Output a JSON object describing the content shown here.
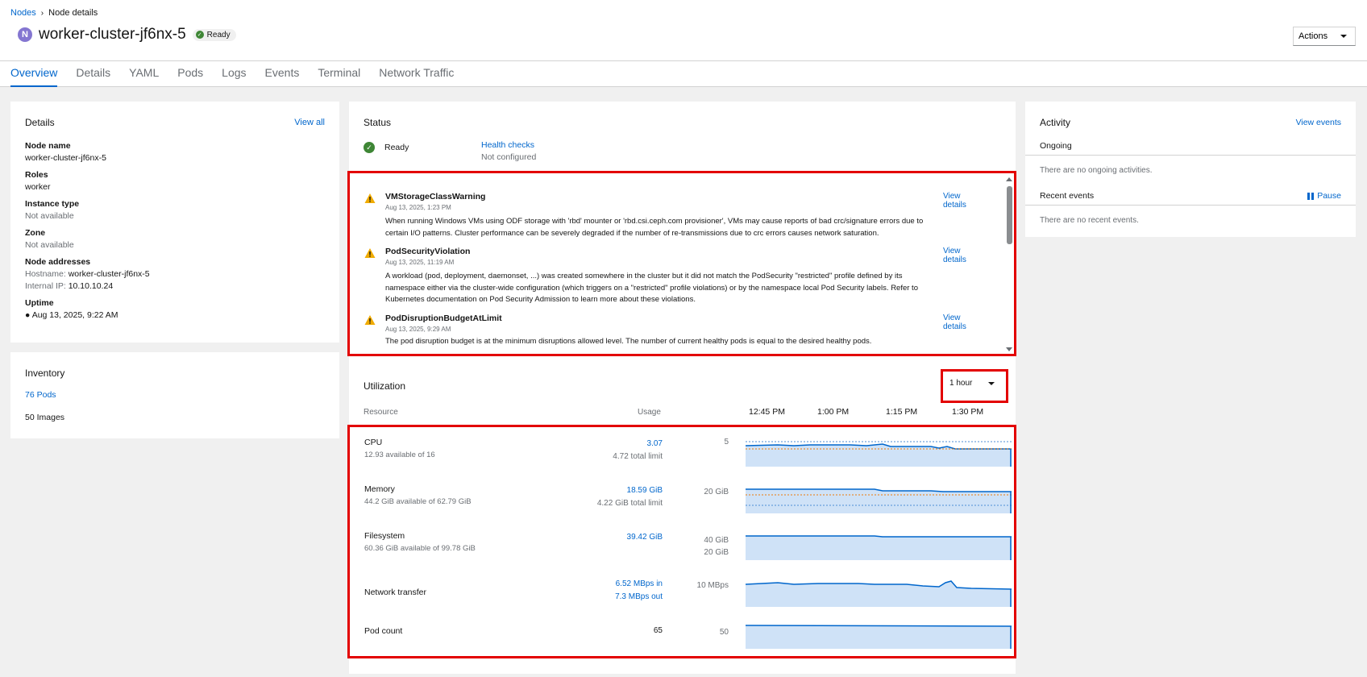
{
  "breadcrumb": {
    "parent": "Nodes",
    "current": "Node details"
  },
  "node": {
    "badge": "N",
    "name": "worker-cluster-jf6nx-5",
    "status": "Ready"
  },
  "header": {
    "actions_label": "Actions"
  },
  "tabs": [
    {
      "label": "Overview",
      "active": true
    },
    {
      "label": "Details"
    },
    {
      "label": "YAML"
    },
    {
      "label": "Pods"
    },
    {
      "label": "Logs"
    },
    {
      "label": "Events"
    },
    {
      "label": "Terminal"
    },
    {
      "label": "Network Traffic"
    }
  ],
  "details": {
    "title": "Details",
    "view_all": "View all",
    "node_name_label": "Node name",
    "node_name": "worker-cluster-jf6nx-5",
    "roles_label": "Roles",
    "roles": "worker",
    "instance_type_label": "Instance type",
    "instance_type": "Not available",
    "zone_label": "Zone",
    "zone": "Not available",
    "addresses_label": "Node addresses",
    "hostname_label": "Hostname:",
    "hostname": "worker-cluster-jf6nx-5",
    "internal_ip_label": "Internal IP:",
    "internal_ip": "10.10.10.24",
    "uptime_label": "Uptime",
    "uptime": "Aug 13, 2025, 9:22 AM"
  },
  "inventory": {
    "title": "Inventory",
    "pods": "76 Pods",
    "images": "50 Images"
  },
  "status": {
    "title": "Status",
    "state": "Ready",
    "health_checks": "Health checks",
    "health_state": "Not configured",
    "view_details": "View details",
    "alerts": [
      {
        "name": "VMStorageClassWarning",
        "time": "Aug 13, 2025, 1:23 PM",
        "description": "When running Windows VMs using ODF storage with 'rbd' mounter or 'rbd.csi.ceph.com provisioner', VMs may cause reports of bad crc/signature errors due to certain I/O patterns. Cluster performance can be severely degraded if the number of re-transmissions due to crc errors causes network saturation."
      },
      {
        "name": "PodSecurityViolation",
        "time": "Aug 13, 2025, 11:19 AM",
        "description": "A workload (pod, deployment, daemonset, ...) was created somewhere in the cluster but it did not match the PodSecurity \"restricted\" profile defined by its namespace either via the cluster-wide configuration (which triggers on a \"restricted\" profile violations) or by the namespace local Pod Security labels. Refer to Kubernetes documentation on Pod Security Admission to learn more about these violations."
      },
      {
        "name": "PodDisruptionBudgetAtLimit",
        "time": "Aug 13, 2025, 9:29 AM",
        "description": "The pod disruption budget is at the minimum disruptions allowed level. The number of current healthy pods is equal to the desired healthy pods."
      }
    ]
  },
  "utilization": {
    "title": "Utilization",
    "time_range": "1 hour",
    "col_resource": "Resource",
    "col_usage": "Usage",
    "time_ticks": [
      "12:45 PM",
      "1:00 PM",
      "1:15 PM",
      "1:30 PM"
    ],
    "resources": [
      {
        "name": "CPU",
        "sub": "12.93 available of 16",
        "value": "3.07",
        "extra": "4.72 total limit",
        "axis": [
          "5"
        ]
      },
      {
        "name": "Memory",
        "sub": "44.2 GiB available of 62.79 GiB",
        "value": "18.59 GiB",
        "extra": "4.22 GiB total limit",
        "axis": [
          "20 GiB"
        ]
      },
      {
        "name": "Filesystem",
        "sub": "60.36 GiB available of 99.78 GiB",
        "value": "39.42 GiB",
        "extra": "",
        "axis": [
          "40 GiB",
          "20 GiB"
        ]
      },
      {
        "name": "Network transfer",
        "sub": "",
        "value": "6.52 MBps in",
        "extra": "7.3 MBps out",
        "axis": [
          "10 MBps"
        ]
      },
      {
        "name": "Pod count",
        "sub": "",
        "value": "65",
        "extra": "",
        "axis": [
          "50"
        ]
      }
    ]
  },
  "activity": {
    "title": "Activity",
    "view_events": "View events",
    "ongoing": "Ongoing",
    "ongoing_empty": "There are no ongoing activities.",
    "recent": "Recent events",
    "pause": "Pause",
    "recent_empty": "There are no recent events."
  },
  "colors": {
    "accent": "#0066cc",
    "highlight": "#e30000",
    "warning": "#f0ab00",
    "success": "#3e8635"
  }
}
